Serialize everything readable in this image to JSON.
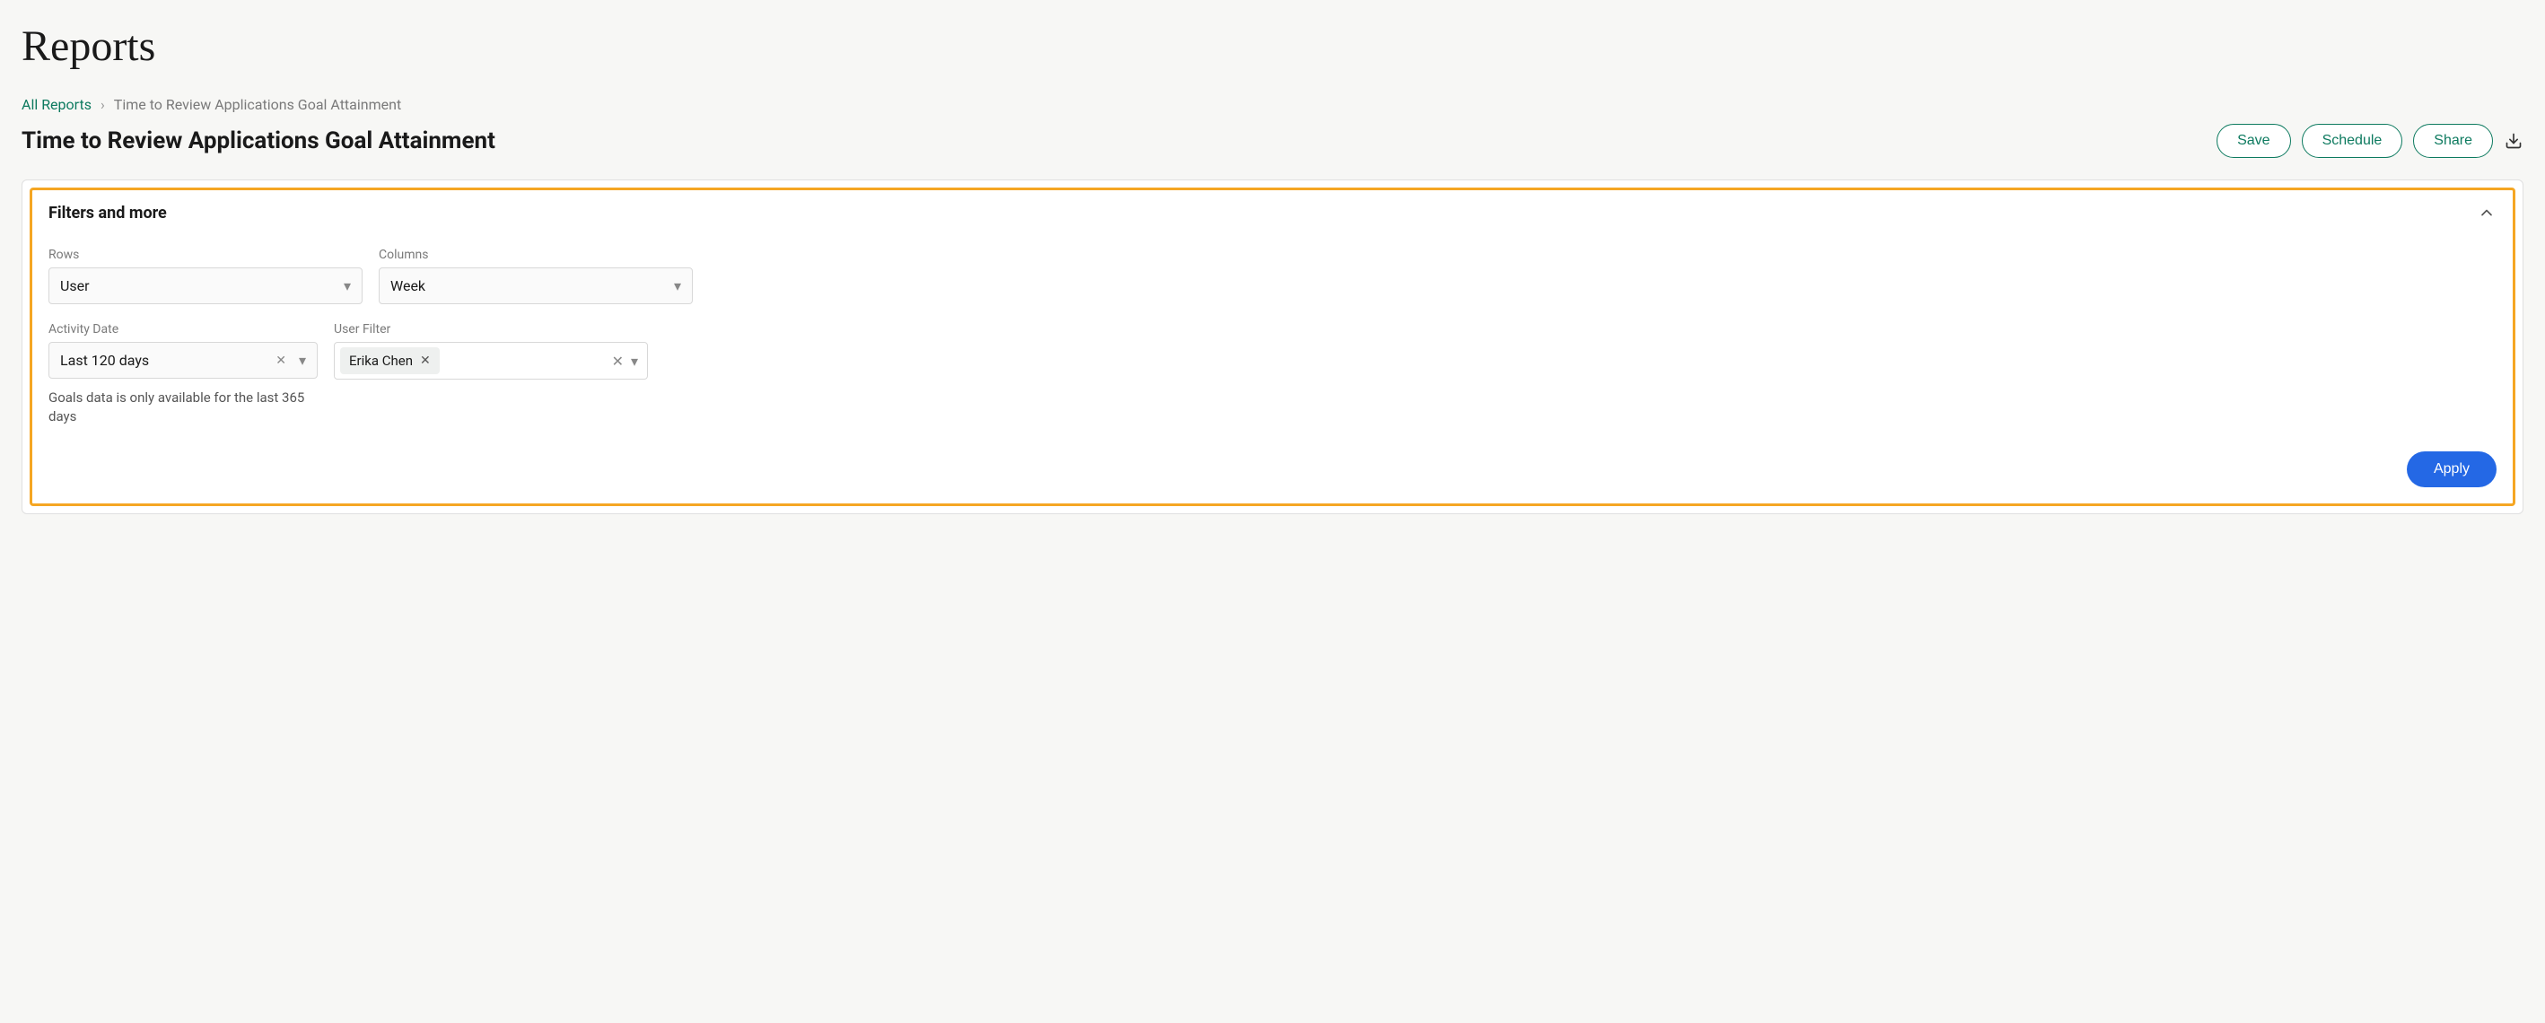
{
  "page": {
    "title": "Reports"
  },
  "breadcrumb": {
    "root": "All Reports",
    "separator": "›",
    "current": "Time to Review Applications Goal Attainment"
  },
  "report": {
    "title": "Time to Review Applications Goal Attainment"
  },
  "actions": {
    "save": "Save",
    "schedule": "Schedule",
    "share": "Share"
  },
  "panel": {
    "title": "Filters and more",
    "rows_label": "Rows",
    "rows_value": "User",
    "columns_label": "Columns",
    "columns_value": "Week",
    "activity_label": "Activity Date",
    "activity_value": "Last 120 days",
    "activity_hint": "Goals data is only available for the last 365 days",
    "userfilter_label": "User Filter",
    "userfilter_chip": "Erika Chen",
    "apply": "Apply"
  }
}
